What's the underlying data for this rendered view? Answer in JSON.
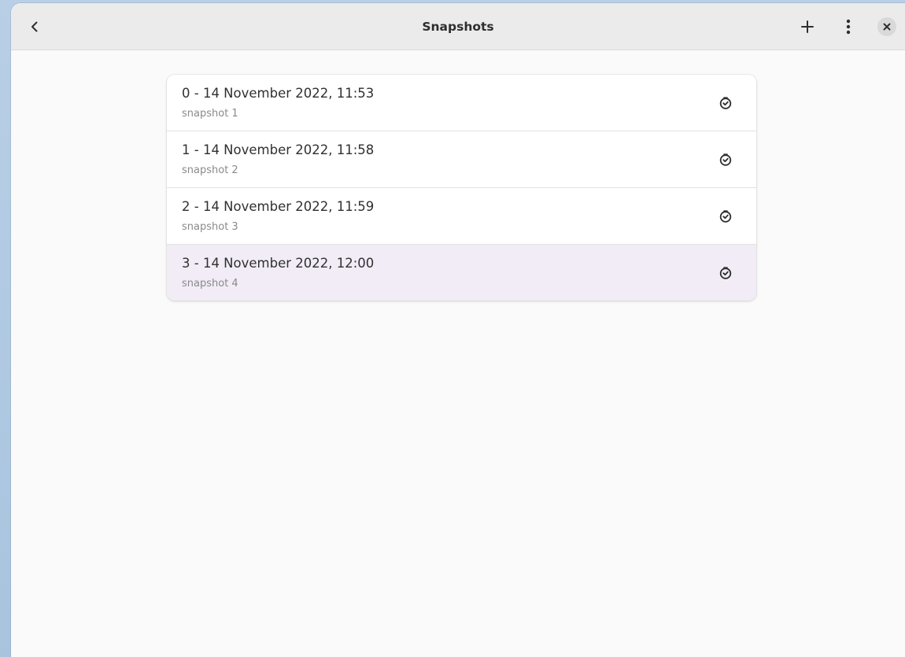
{
  "window": {
    "title": "Snapshots"
  },
  "headerbar": {
    "back_icon": "chevron-left-icon",
    "add_icon": "plus-icon",
    "menu_icon": "vertical-ellipsis-icon",
    "close_icon": "close-icon"
  },
  "snapshots": [
    {
      "title": "0 - 14 November 2022, 11:53",
      "subtitle": "snapshot 1",
      "icon": "restore-clock-icon",
      "selected": false
    },
    {
      "title": "1 - 14 November 2022, 11:58",
      "subtitle": "snapshot 2",
      "icon": "restore-clock-icon",
      "selected": false
    },
    {
      "title": "2 - 14 November 2022, 11:59",
      "subtitle": "snapshot 3",
      "icon": "restore-clock-icon",
      "selected": false
    },
    {
      "title": "3 - 14 November 2022, 12:00",
      "subtitle": "snapshot 4",
      "icon": "restore-clock-icon",
      "selected": true
    }
  ],
  "colors": {
    "headerbar_bg": "#ebebeb",
    "content_bg": "#fafafa",
    "selected_row_bg": "#f1ecf6",
    "desktop_bg": "#b8cfe6"
  }
}
